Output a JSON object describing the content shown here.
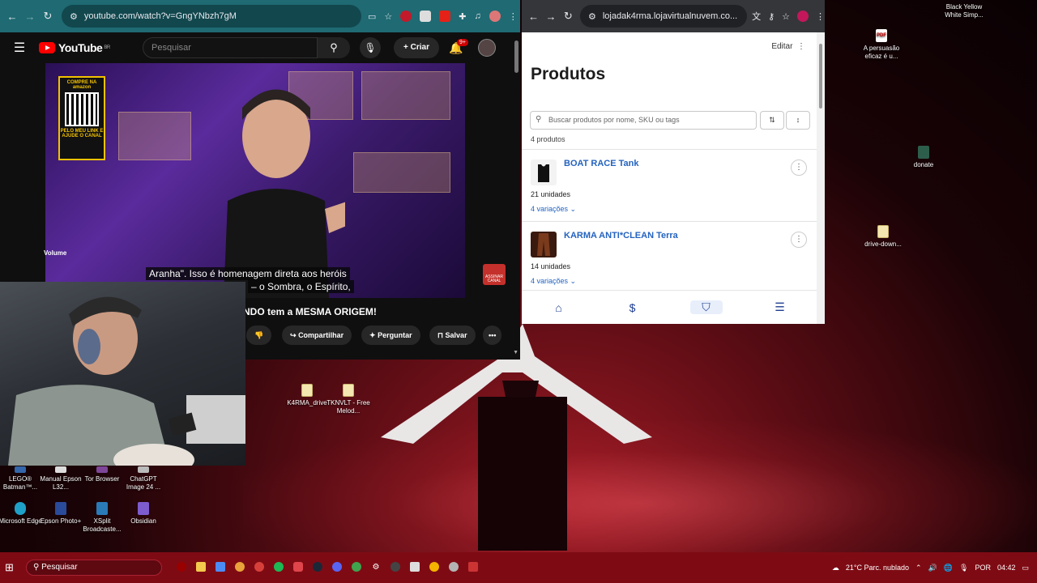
{
  "youtube_window": {
    "url": "youtube.com/watch?v=GngYNbzh7gM",
    "search_placeholder": "Pesquisar",
    "logo_text": "YouTube",
    "logo_region": "BR",
    "create_label": "Criar",
    "notification_count": "9+",
    "video_overlay_volume": "Volume",
    "qr_top": "COMPRE NA amazon",
    "qr_bottom": "PELO MEU LINK E AJUDE O CANAL",
    "subscribe_label": "ASSINAR CANAL",
    "caption_line1": "Aranha\". Isso é homenagem direta aos heróis",
    "caption_line2": "– o Sombra, o Espírito,",
    "title_visible": "NDO tem a MESMA ORIGEM!",
    "actions": {
      "share": "Compartilhar",
      "ask": "Perguntar",
      "save": "Salvar"
    }
  },
  "shop_window": {
    "url": "lojadak4rma.lojavirtualnuvem.co...",
    "edit_label": "Editar",
    "page_title": "Produtos",
    "search_placeholder": "Buscar produtos por nome, SKU ou tags",
    "product_count": "4 produtos",
    "products": [
      {
        "name": "BOAT RACE Tank",
        "quantity": "21 unidades",
        "variations": "4 variações",
        "thumb_color": "#111111"
      },
      {
        "name": "KARMA ANTI*CLEAN Terra",
        "quantity": "14 unidades",
        "variations": "4 variações",
        "thumb_color": "#7a3a1c"
      }
    ]
  },
  "desktop_icons": {
    "top_right": "Black Yellow White Simp...",
    "pdf": "A persuasão eficaz é u...",
    "donate": "donate",
    "drive_download": "drive-down...",
    "karma_drive": "K4RMA_drive",
    "tknvlt": "TKNVLT - Free Melod...",
    "lego": "LEGO® Batman™...",
    "manual_epson": "Manual Epson L32...",
    "tor": "Tor Browser",
    "chatgpt": "ChatGPT Image 24 ...",
    "edge": "Microsoft Edge",
    "epson_photo": "Epson Photo+",
    "xsplit": "XSplit Broadcaste...",
    "obsidian": "Obsidian"
  },
  "taskbar": {
    "search_label": "Pesquisar",
    "weather": "21°C  Parc. nublado",
    "language": "POR",
    "time": "04:42"
  }
}
